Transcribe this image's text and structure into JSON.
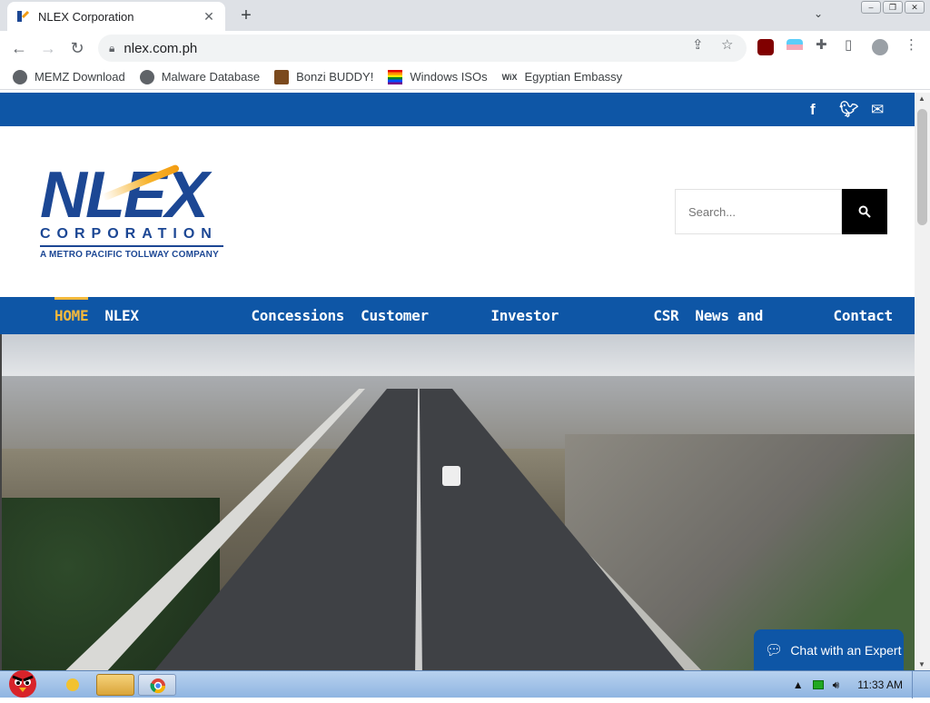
{
  "browser": {
    "tab_title": "NLEX Corporation",
    "url": "nlex.com.ph",
    "bookmarks": [
      {
        "label": "MEMZ Download"
      },
      {
        "label": "Malware Database"
      },
      {
        "label": "Bonzi BUDDY!"
      },
      {
        "label": "Windows ISOs"
      },
      {
        "label": "Egyptian Embassy"
      }
    ]
  },
  "site": {
    "logo": {
      "brand": "NLEX",
      "corp": "CORPORATION",
      "tagline": "A METRO PACIFIC TOLLWAY COMPANY"
    },
    "search_placeholder": "Search...",
    "nav": [
      {
        "label": "HOME",
        "active": true
      },
      {
        "label": "NLEX Corporation"
      },
      {
        "label": "Concessions"
      },
      {
        "label": "Customer Focus"
      },
      {
        "label": "Investor Relations"
      },
      {
        "label": "CSR"
      },
      {
        "label": "News and Events"
      },
      {
        "label": "Contact Us"
      }
    ],
    "chat_label": "Chat with an Expert"
  },
  "taskbar": {
    "clock": "11:33 AM"
  },
  "colors": {
    "brand_blue": "#0e56a6",
    "accent_gold": "#f5b93b"
  }
}
